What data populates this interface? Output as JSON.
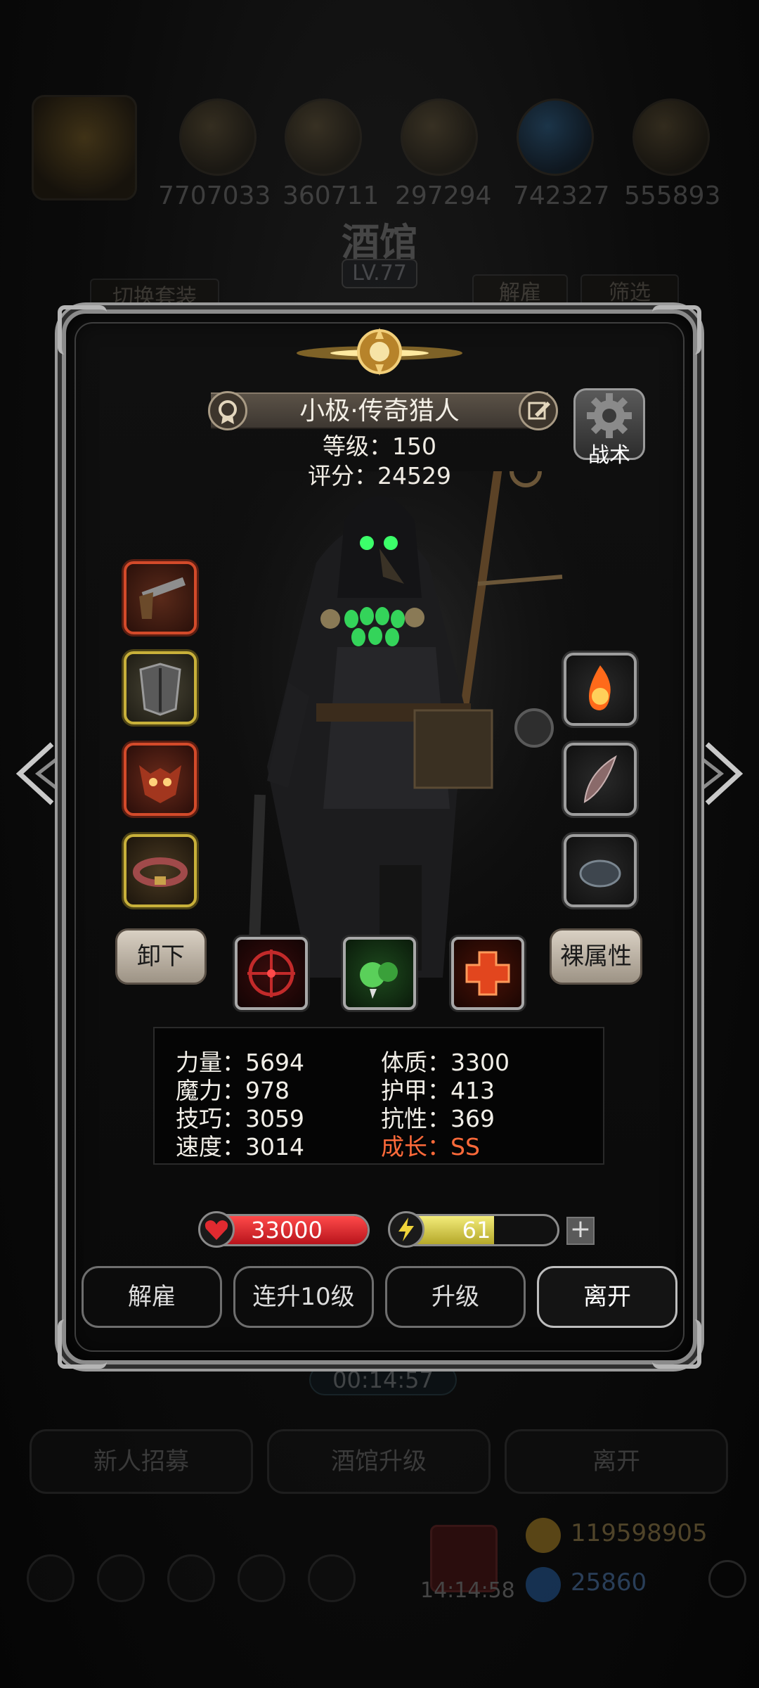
{
  "background": {
    "resources": [
      "7707033",
      "360711",
      "297294",
      "742327",
      "555893"
    ],
    "title": "酒馆",
    "level": "LV.77",
    "switch_outfit": "切换套装",
    "dismiss": "解雇",
    "filter": "筛选",
    "timer": "00:14:57",
    "bottom_buttons": [
      "新人招募",
      "酒馆升级",
      "离开"
    ],
    "gift_timer": "14:14:58",
    "gold": "119598905",
    "gems": "25860"
  },
  "hero": {
    "name": "小极·传奇猎人",
    "level_text": "等级：150",
    "score_text": "评分：24529",
    "tactics_label": "战术",
    "unequip_label": "卸下",
    "naked_attr_label": "裸属性"
  },
  "equipment_left": [
    {
      "icon": "pistol-icon",
      "frame": "red"
    },
    {
      "icon": "armor-icon",
      "frame": "gold"
    },
    {
      "icon": "demon-mask-icon",
      "frame": "red"
    },
    {
      "icon": "belt-icon",
      "frame": "gold"
    }
  ],
  "equipment_right": [
    {
      "icon": "fire-orb-icon"
    },
    {
      "icon": "feather-icon"
    },
    {
      "icon": "stone-icon"
    }
  ],
  "skills": [
    "crosshair-skill-icon",
    "poison-skill-icon",
    "heal-cross-skill-icon"
  ],
  "stats": {
    "strength": "力量：5694",
    "magic": "魔力：978",
    "skill": "技巧：3059",
    "speed": "速度：3014",
    "constitution": "体质：3300",
    "armor": "护甲：413",
    "resistance": "抗性：369",
    "growth": "成长：SS"
  },
  "hp": {
    "value": "33000",
    "fill_fraction": 1.0
  },
  "energy": {
    "value": "61",
    "fill_fraction": 0.61
  },
  "actions": {
    "dismiss": "解雇",
    "level_up_10": "连升10级",
    "level_up": "升级",
    "leave": "离开"
  },
  "colors": {
    "accent_red": "#d34a2a",
    "accent_gold": "#c8b03a",
    "growth_highlight": "#ff6a3a",
    "hp_bar": "#d8222a",
    "energy_bar": "#e4d84a"
  }
}
